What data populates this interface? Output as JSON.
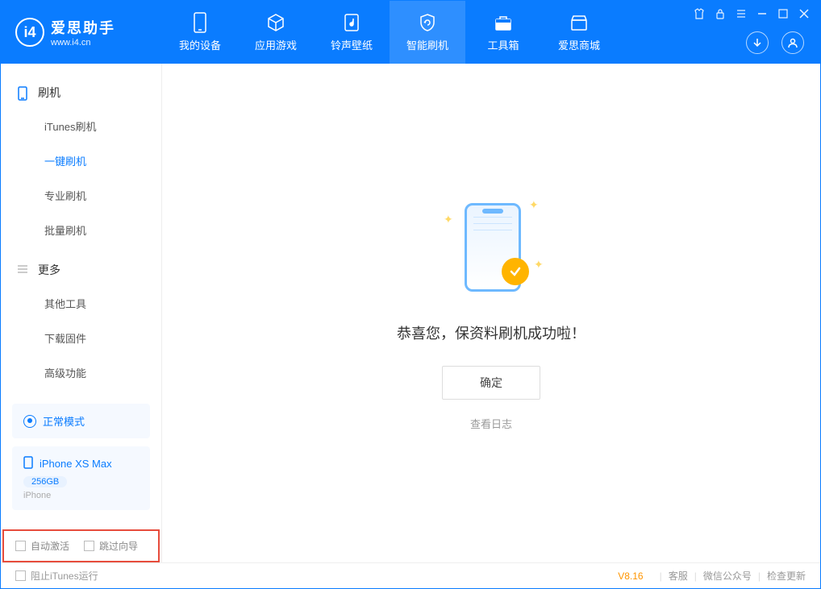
{
  "app": {
    "name_cn": "爱思助手",
    "name_en": "www.i4.cn"
  },
  "nav": {
    "items": [
      {
        "label": "我的设备"
      },
      {
        "label": "应用游戏"
      },
      {
        "label": "铃声壁纸"
      },
      {
        "label": "智能刷机"
      },
      {
        "label": "工具箱"
      },
      {
        "label": "爱思商城"
      }
    ]
  },
  "sidebar": {
    "section1": {
      "title": "刷机",
      "items": [
        "iTunes刷机",
        "一键刷机",
        "专业刷机",
        "批量刷机"
      ]
    },
    "section2": {
      "title": "更多",
      "items": [
        "其他工具",
        "下载固件",
        "高级功能"
      ]
    },
    "mode": {
      "label": "正常模式"
    },
    "device": {
      "name": "iPhone XS Max",
      "storage": "256GB",
      "type": "iPhone"
    },
    "cb1": "自动激活",
    "cb2": "跳过向导"
  },
  "main": {
    "success_msg": "恭喜您，保资料刷机成功啦！",
    "ok_label": "确定",
    "log_link": "查看日志"
  },
  "footer": {
    "block_itunes": "阻止iTunes运行",
    "version": "V8.16",
    "links": [
      "客服",
      "微信公众号",
      "检查更新"
    ]
  }
}
